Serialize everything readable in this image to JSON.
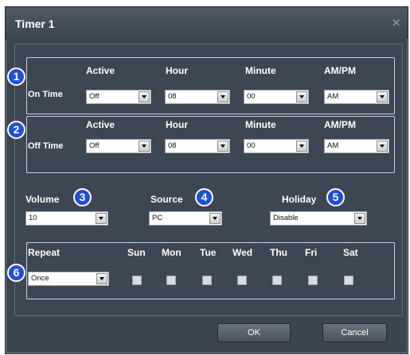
{
  "dialog": {
    "title": "Timer 1",
    "close_icon": "close-icon"
  },
  "on_time": {
    "row_label": "On Time",
    "headers": {
      "active": "Active",
      "hour": "Hour",
      "minute": "Minute",
      "ampm": "AM/PM"
    },
    "values": {
      "active": "Off",
      "hour": "08",
      "minute": "00",
      "ampm": "AM"
    }
  },
  "off_time": {
    "row_label": "Off Time",
    "headers": {
      "active": "Active",
      "hour": "Hour",
      "minute": "Minute",
      "ampm": "AM/PM"
    },
    "values": {
      "active": "Off",
      "hour": "08",
      "minute": "00",
      "ampm": "AM"
    }
  },
  "volume": {
    "label": "Volume",
    "value": "10"
  },
  "source": {
    "label": "Source",
    "value": "PC"
  },
  "holiday": {
    "label": "Holiday",
    "value": "Disable"
  },
  "repeat": {
    "label": "Repeat",
    "value": "Once",
    "days": [
      "Sun",
      "Mon",
      "Tue",
      "Wed",
      "Thu",
      "Fri",
      "Sat"
    ]
  },
  "badges": [
    "1",
    "2",
    "3",
    "4",
    "5",
    "6"
  ],
  "buttons": {
    "ok": "OK",
    "cancel": "Cancel"
  },
  "colors": {
    "dialog_bg": "#3b4451",
    "badge": "#1f4fd8",
    "group_border": "#c9d0e6"
  }
}
